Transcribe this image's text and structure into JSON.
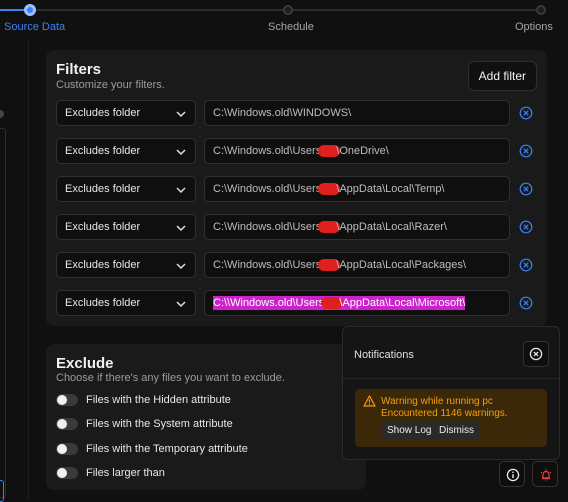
{
  "stepper": {
    "steps": [
      {
        "label": "Source Data",
        "state": "active"
      },
      {
        "label": "Schedule",
        "state": "inactive"
      },
      {
        "label": "Options",
        "state": "inactive"
      }
    ]
  },
  "filters": {
    "title": "Filters",
    "subtitle": "Customize your filters.",
    "add_label": "Add filter",
    "rows": [
      {
        "type": "Excludes folder",
        "path": "C:\\Windows.old\\WINDOWS\\",
        "redacted": false
      },
      {
        "type": "Excludes folder",
        "path_before": "C:\\Windows.old\\Users\\",
        "path_after": "\\OneDrive\\",
        "redacted": true
      },
      {
        "type": "Excludes folder",
        "path_before": "C:\\Windows.old\\Users\\",
        "path_after": "\\AppData\\Local\\Temp\\",
        "redacted": true
      },
      {
        "type": "Excludes folder",
        "path_before": "C:\\Windows.old\\Users\\",
        "path_after": "\\AppData\\Local\\Razer\\",
        "redacted": true
      },
      {
        "type": "Excludes folder",
        "path_before": "C:\\Windows.old\\Users\\",
        "path_after": "\\AppData\\Local\\Packages\\",
        "redacted": true
      },
      {
        "type": "Excludes folder",
        "path_before": "C:\\\\Windows.old\\Users\\",
        "path_after": "\\AppData\\Local\\Microsoft\\",
        "redacted": true,
        "selected": true
      }
    ]
  },
  "exclude": {
    "title": "Exclude",
    "subtitle": "Choose if there's any files you want to exclude.",
    "options": [
      {
        "label": "Files with the Hidden attribute",
        "enabled": false
      },
      {
        "label": "Files with the System attribute",
        "enabled": false
      },
      {
        "label": "Files with the Temporary attribute",
        "enabled": false
      },
      {
        "label": "Files larger than",
        "enabled": false
      }
    ]
  },
  "notifications": {
    "title": "Notifications",
    "warning_title": "Warning while running pc",
    "warning_body": "Encountered 1146 warnings.",
    "show_log": "Show Log",
    "dismiss": "Dismiss"
  },
  "colors": {
    "accent": "#3b82f6",
    "warning": "#f59e0b",
    "alert": "#ef4444",
    "highlight": "#cc22cc"
  }
}
